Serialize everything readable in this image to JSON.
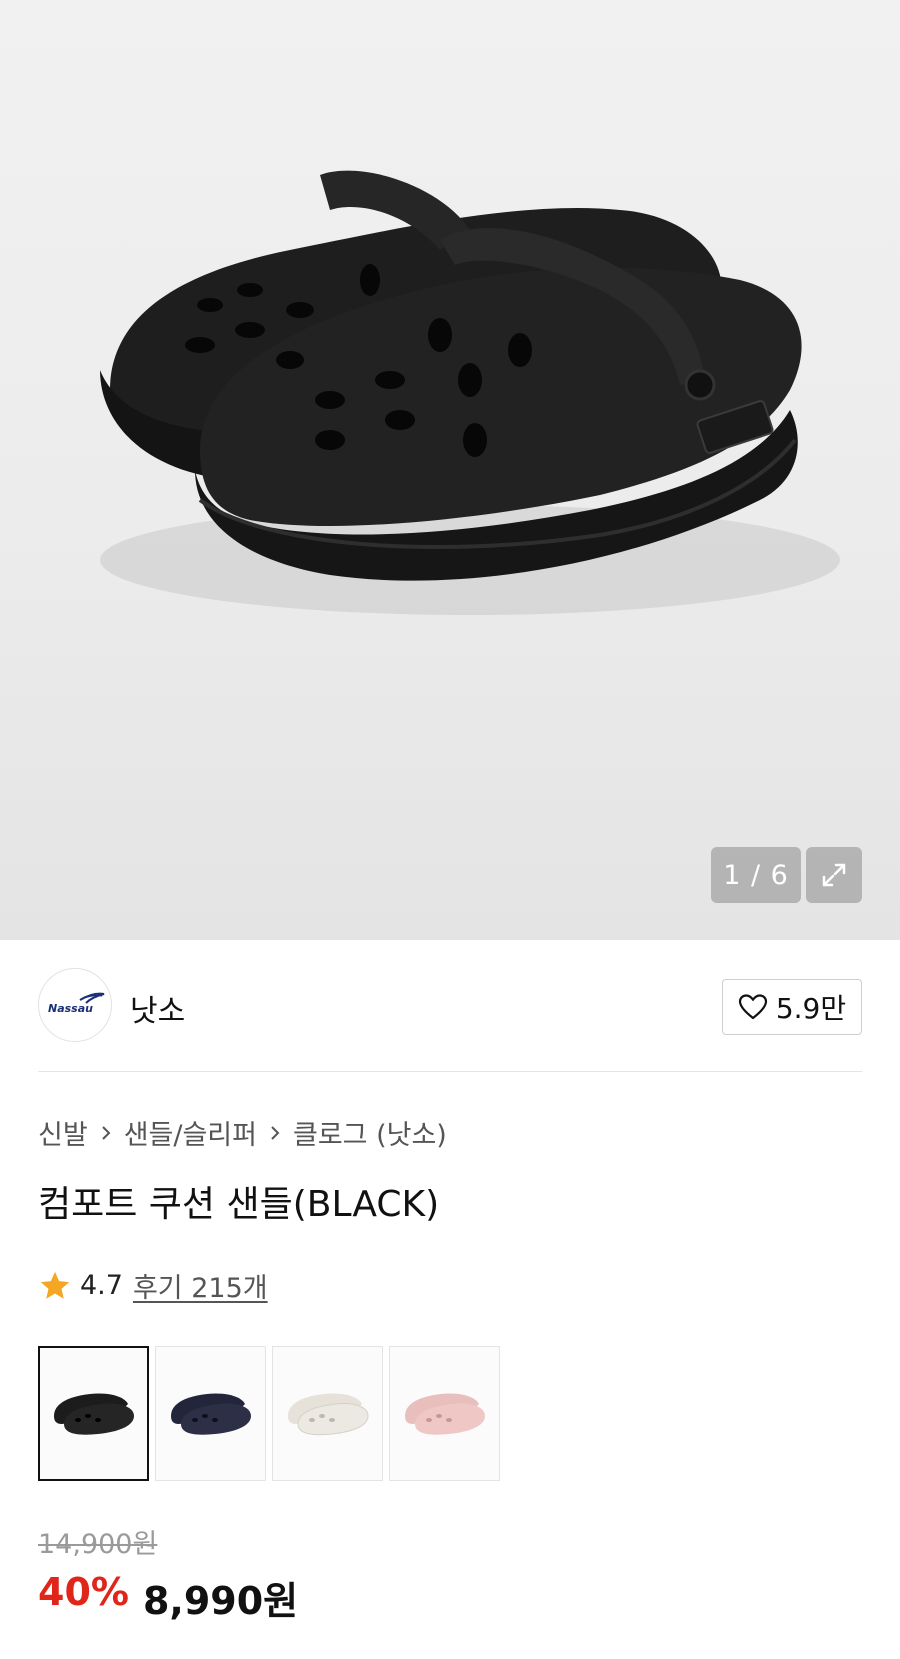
{
  "gallery": {
    "counter": "1 / 6",
    "expand_icon": "expand-icon"
  },
  "brand": {
    "logo_text": "Nassau",
    "name": "낫소",
    "like_count": "5.9만",
    "like_icon": "heart-outline-icon"
  },
  "breadcrumb": {
    "items": [
      "신발",
      "샌들/슬리퍼",
      "클로그 (낫소)"
    ]
  },
  "product": {
    "title": "컴포트 쿠션 샌들(BLACK)",
    "rating": "4.7",
    "reviews": "후기 215개",
    "colors": {
      "black": "#1c1c1c",
      "navy": "#23263a",
      "ivory": "#ece9e2",
      "pink": "#efc8c6"
    }
  },
  "price": {
    "original": "14,900원",
    "discount": "40%",
    "sale": "8,990원"
  },
  "accent": {
    "discount_color": "#e0261b",
    "star_color": "#f5a623"
  }
}
